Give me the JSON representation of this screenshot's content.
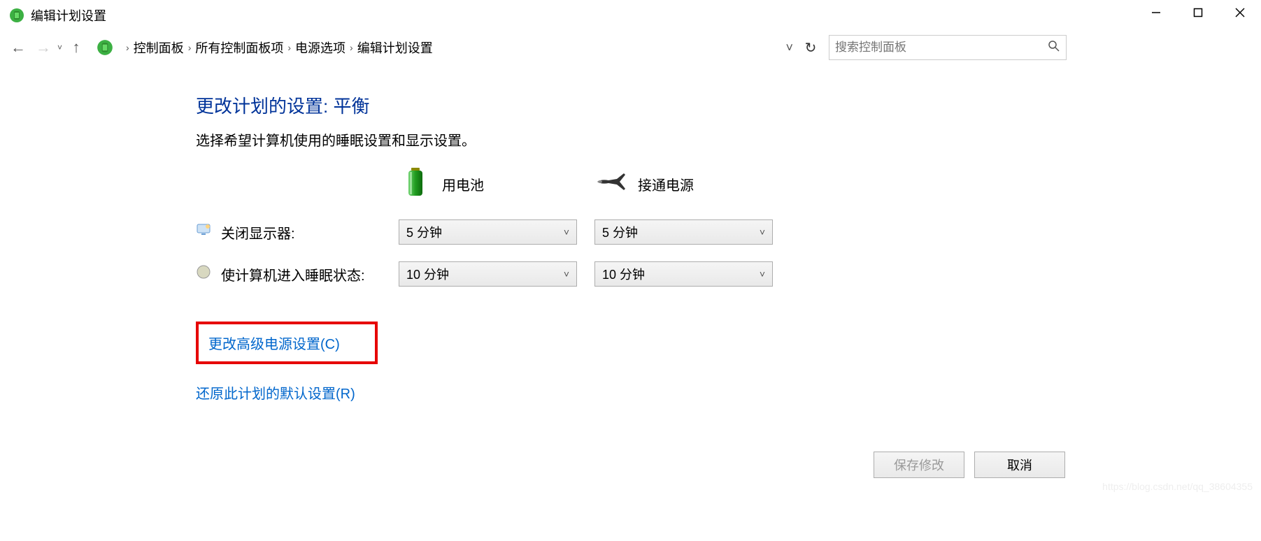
{
  "window": {
    "title": "编辑计划设置"
  },
  "breadcrumb": {
    "items": [
      "控制面板",
      "所有控制面板项",
      "电源选项",
      "编辑计划设置"
    ]
  },
  "search": {
    "placeholder": "搜索控制面板"
  },
  "page": {
    "title": "更改计划的设置: 平衡",
    "description": "选择希望计算机使用的睡眠设置和显示设置。"
  },
  "headers": {
    "battery": "用电池",
    "plugged": "接通电源"
  },
  "rows": {
    "display": {
      "label": "关闭显示器:",
      "battery": "5 分钟",
      "plugged": "5 分钟"
    },
    "sleep": {
      "label": "使计算机进入睡眠状态:",
      "battery": "10 分钟",
      "plugged": "10 分钟"
    }
  },
  "links": {
    "advanced": "更改高级电源设置(C)",
    "restore": "还原此计划的默认设置(R)"
  },
  "buttons": {
    "save": "保存修改",
    "cancel": "取消"
  },
  "watermark": "https://blog.csdn.net/qq_38604355"
}
